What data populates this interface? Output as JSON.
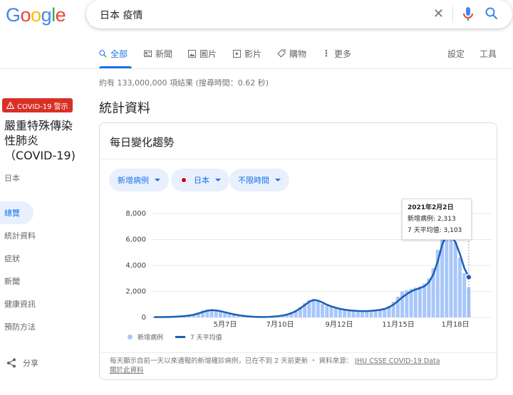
{
  "logo": {
    "text": "Google"
  },
  "search": {
    "query": "日本 疫情"
  },
  "tabs": [
    {
      "label": "全部",
      "icon": "search-icon"
    },
    {
      "label": "新聞",
      "icon": "news-icon"
    },
    {
      "label": "圖片",
      "icon": "image-icon"
    },
    {
      "label": "影片",
      "icon": "video-icon"
    },
    {
      "label": "購物",
      "icon": "tag-icon"
    },
    {
      "label": "更多",
      "icon": "more-icon"
    }
  ],
  "tools": {
    "settings": "設定",
    "tools": "工具"
  },
  "result_stats": "約有 133,000,000 項結果 (搜尋時間：0.62 秒)",
  "section_title": "統計資料",
  "panel": {
    "alert": "COVID-19 警示",
    "disease_line1": "嚴重特殊傳染",
    "disease_line2": "性肺炎",
    "disease_line3": "（COVID-19)",
    "country": "日本",
    "nav": [
      "總覽",
      "統計資料",
      "症狀",
      "新聞",
      "健康資訊",
      "預防方法"
    ],
    "share": "分享"
  },
  "card": {
    "title": "每日變化趨勢",
    "chips": [
      "新增病例",
      "日本",
      "不限時間"
    ]
  },
  "tooltip": {
    "date": "2021年2月2日",
    "cases_label": "新增病例",
    "cases_value": "2,313",
    "avg_label": "7 天平均值",
    "avg_value": "3,103"
  },
  "legend": {
    "bars": "新增病例",
    "line": "7 天平均值"
  },
  "footnote": {
    "text": "每天顯示自前一天以來通報的新增確診病例，已在不到 2 天前更新 ・ 資料來源：",
    "source": "JHU CSSE COVID-19 Data",
    "about": "關於此資料"
  },
  "colors": {
    "accent": "#1a73e8",
    "line": "#1a5fb4",
    "bars": "#a8c7fa",
    "alert": "#d93025"
  },
  "chart_data": {
    "type": "bar",
    "ylim": [
      0,
      8000
    ],
    "yticks": [
      "8,000",
      "6,000",
      "4,000",
      "2,000",
      "0"
    ],
    "xticks": [
      "5月7日",
      "7月10日",
      "9月12日",
      "11月15日",
      "1月18日"
    ],
    "series": [
      {
        "name": "新增病例",
        "values": [
          30,
          35,
          50,
          40,
          60,
          80,
          100,
          140,
          180,
          260,
          400,
          520,
          560,
          560,
          500,
          420,
          340,
          260,
          190,
          140,
          100,
          70,
          50,
          40,
          30,
          40,
          60,
          90,
          120,
          180,
          260,
          400,
          560,
          800,
          1100,
          1350,
          1400,
          1250,
          1050,
          900,
          800,
          700,
          620,
          560,
          520,
          500,
          480,
          470,
          500,
          540,
          560,
          600,
          700,
          900,
          1200,
          1600,
          2000,
          2100,
          2200,
          2300,
          2400,
          2600,
          3000,
          3800,
          5200,
          6800,
          7800,
          7000,
          5800,
          4600,
          3400,
          2313
        ]
      },
      {
        "name": "7 天平均值",
        "values": [
          20,
          25,
          30,
          35,
          45,
          60,
          80,
          110,
          150,
          210,
          300,
          420,
          520,
          560,
          540,
          480,
          400,
          320,
          240,
          180,
          130,
          90,
          60,
          45,
          35,
          35,
          45,
          70,
          100,
          150,
          220,
          330,
          480,
          700,
          950,
          1200,
          1350,
          1300,
          1150,
          980,
          850,
          750,
          660,
          600,
          550,
          520,
          500,
          490,
          490,
          510,
          540,
          580,
          650,
          780,
          980,
          1250,
          1550,
          1800,
          2000,
          2150,
          2250,
          2400,
          2700,
          3300,
          4300,
          5600,
          6400,
          6300,
          5800,
          4900,
          3800,
          3103
        ]
      }
    ]
  }
}
